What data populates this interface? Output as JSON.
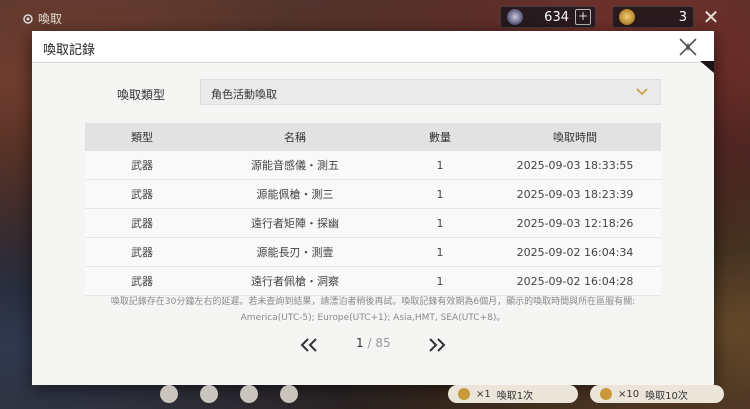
{
  "topbar": {
    "title": "喚取",
    "currency1": {
      "icon": "star-shard-icon",
      "value": "634"
    },
    "currency2": {
      "icon": "coin-icon",
      "value": "3"
    }
  },
  "modal": {
    "title": "喚取記錄",
    "filter_label": "喚取類型",
    "filter_value": "角色活動喚取",
    "columns": [
      "類型",
      "名稱",
      "數量",
      "喚取時間"
    ],
    "rows": [
      [
        "武器",
        "源能音感儀・測五",
        "1",
        "2025-09-03 18:33:55"
      ],
      [
        "武器",
        "源能佩槍・測三",
        "1",
        "2025-09-03 18:23:39"
      ],
      [
        "武器",
        "遠行者矩陣・探幽",
        "1",
        "2025-09-03 12:18:26"
      ],
      [
        "武器",
        "源能長刃・測壹",
        "1",
        "2025-09-02 16:04:34"
      ],
      [
        "武器",
        "遠行者佩槍・洞察",
        "1",
        "2025-09-02 16:04:28"
      ]
    ],
    "note_line1": "喚取記錄存在30分鐘左右的延遲。若未查詢到結果，請漂泊者稍後再試。喚取記錄有效期為6個月，顯示的喚取時間與所在區服有關:",
    "note_line2": "America(UTC-5); Europe(UTC+1); Asia,HMT, SEA(UTC+8)。",
    "page_current": "1",
    "page_total": "/ 85"
  },
  "bottom": {
    "pull1_label": "×1",
    "pull1_text": "喚取1次",
    "pull10_label": "×10",
    "pull10_text": "喚取10次"
  },
  "colors": {
    "accent": "#c9a24a",
    "panel": "#f5f5f4"
  }
}
